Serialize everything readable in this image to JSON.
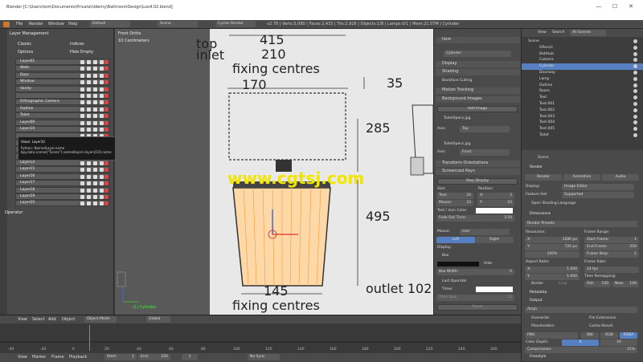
{
  "window": {
    "title": "Blender [C:\\Users\\tom\\Documents\\Private\\Udemy\\BathroomDesign\\Loo4.02.blend]",
    "controls": [
      "—",
      "☐",
      "✕"
    ]
  },
  "menubar": {
    "items": [
      "File",
      "Render",
      "Window",
      "Help"
    ],
    "layout": "Default",
    "scene": "Scene",
    "engine": "Cycles Render",
    "stats": "v2.78 | Verts:5,080 | Faces:2,433 | Tris:2,926 | Objects:1/8 | Lamps:0/1 | Mem:21.07M | Cylinder"
  },
  "left_panel": {
    "title": "Layer Management",
    "options": [
      "Classic",
      "Indices",
      "Options",
      "Hide Empty"
    ],
    "layers": [
      "Layer01",
      "Walls",
      "Door",
      "Window",
      "Vanity",
      "",
      "Orthographic Camera",
      "Outline",
      "Toilet",
      "Layer09",
      "Layer10",
      "",
      "",
      "",
      "",
      "Layer14",
      "Layer15",
      "Layer16",
      "Layer17",
      "Layer18",
      "Layer19",
      "Layer20"
    ],
    "operator_label": "Operator"
  },
  "tooltip": {
    "line1": "Value: Layer10",
    "line2": "Python: NamedLayer.name",
    "line3": "bpy.data.scenes[\"Scene\"].namedlayers.layers[10].name"
  },
  "viewport": {
    "view_name": "Front Ortho",
    "unit": "10 Centimeters",
    "watermark": "www.cgtsj.com",
    "drawing": {
      "top_inlet": "top\ninlet",
      "d415": "415",
      "d210": "210",
      "fixing_top": "fixing centres",
      "d170": "170",
      "d35": "35",
      "d285": "285",
      "d495": "495",
      "d145": "145",
      "fixing_bottom": "fixing centres",
      "outlet": "outlet 102"
    },
    "cursor_label": "(1) Cylinder"
  },
  "n_panel": {
    "item_header": "Item",
    "object_name": "Cylinder",
    "display": "Display",
    "shading": "Shading",
    "backface": "Backface Culling",
    "motion": "Motion Tracking",
    "bg_images": "Background Images",
    "add_image": "Add Image",
    "img1": "ToiletSpecs.jpg",
    "axis_label": "Axis:",
    "axis1": "Top",
    "img2": "ToiletSpecs.jpg",
    "axis2": "Front",
    "transform_orient": "Transform Orientations",
    "screencast": "Screencast Keys",
    "stop_display": "Stop Display",
    "size": "Size:",
    "position": "Position:",
    "text_val": "Text:",
    "text_num": "24",
    "x_label": "X:",
    "x_num": "3",
    "mouse_val": "Mouse:",
    "mouse_num": "33",
    "y_label": "Y:",
    "y_num": "10",
    "icon_color": "Text / Icon Color:",
    "fade": "Fade Out Time:",
    "fade_val": "3.50",
    "mouse_lbl": "Mouse:",
    "mouse_mode": "Icon",
    "left": "Left",
    "right": "Right",
    "display_lbl": "Display:",
    "box": "Box",
    "hide": "Hide",
    "box_width": "Box Width:",
    "box_width_val": "0",
    "last_op": "Last Operator",
    "timer": "Timer",
    "time_size": "Time Size:",
    "time_size_val": "12",
    "reset": "Reset"
  },
  "outliner": {
    "header_view": "View",
    "header_search": "Search",
    "header_scenes": "All Scenes",
    "rows": [
      "Scene",
      "GPencil",
      "Bathtub",
      "Camera",
      "Cylinder",
      "Doorway",
      "Lamp",
      "Outline",
      "Room",
      "Text",
      "Text.001",
      "Text.002",
      "Text.003",
      "Text.004",
      "Text.005",
      "Toilet"
    ]
  },
  "properties": {
    "scene": "Scene",
    "render_header": "Render",
    "tab_render": "Render",
    "tab_anim": "Animation",
    "tab_audio": "Audio",
    "display": "Display:",
    "display_val": "Image Editor",
    "feature_set": "Feature Set:",
    "feature_val": "Supported",
    "open_shading": "Open Shading Language",
    "dimensions": "Dimensions",
    "presets": "Render Presets",
    "resolution": "Resolution:",
    "res_x": "X:",
    "res_x_val": "1280 px",
    "res_y": "Y:",
    "res_y_val": "720 px",
    "res_pct": "100%",
    "frame_range": "Frame Range:",
    "start_frame": "Start Frame:",
    "start_val": "1",
    "end_frame": "End Frame:",
    "end_val": "250",
    "frame_step": "Frame Step:",
    "step_val": "1",
    "aspect": "Aspect Ratio:",
    "asp_x": "X:",
    "asp_x_val": "1.000",
    "asp_y": "Y:",
    "asp_y_val": "1.000",
    "frame_rate": "Frame Rate:",
    "fps": "24 fps",
    "time_remap": "Time Remapping:",
    "border": "Border",
    "crop": "Crop",
    "old": "Old:",
    "old_val": "100",
    "new": "New:",
    "new_val": "100",
    "metadata": "Metadata",
    "output": "Output",
    "output_path": "/tmp\\",
    "overwrite": "Overwrite",
    "file_ext": "File Extensions",
    "placeholders": "Placeholders",
    "cache_result": "Cache Result",
    "format": "PNG",
    "bw": "BW",
    "rgb": "RGB",
    "rgba": "RGBA",
    "color_depth": "Color Depth:",
    "cd8": "8",
    "cd16": "16",
    "compression": "Compression:",
    "compression_val": "15%",
    "freestyle": "Freestyle"
  },
  "timeline": {
    "menu": [
      "View",
      "Select",
      "Add",
      "Object"
    ],
    "mode": "Object Mode",
    "global": "Global",
    "bottom_menu": [
      "View",
      "Marker",
      "Frame",
      "Playback"
    ],
    "start": "Start:",
    "start_val": "1",
    "end": "End:",
    "end_val": "250",
    "current": "1",
    "sync": "No Sync",
    "ticks": [
      "-40",
      "-20",
      "0",
      "20",
      "40",
      "60",
      "80",
      "100",
      "120",
      "140",
      "160",
      "180",
      "200",
      "220",
      "240",
      "260"
    ]
  }
}
